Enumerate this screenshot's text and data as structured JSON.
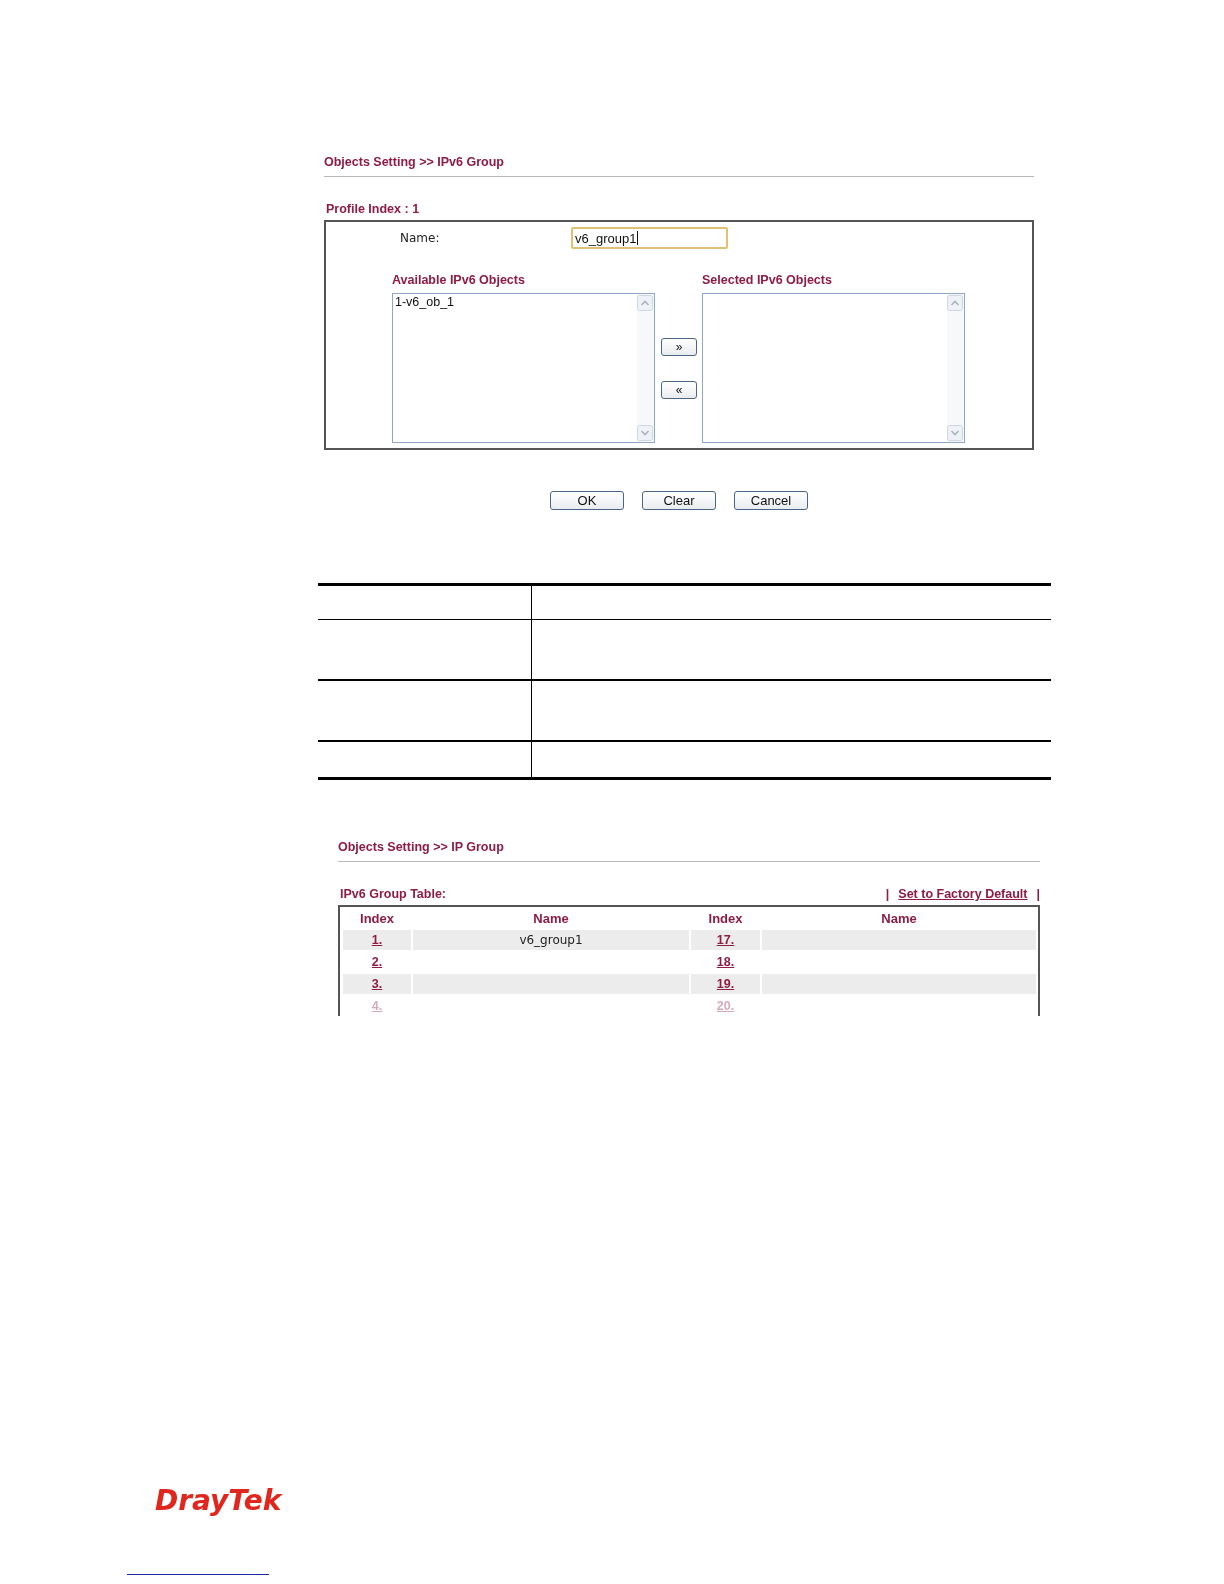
{
  "ipv6_group_page": {
    "breadcrumb": "Objects Setting >> IPv6 Group",
    "profile_index": "Profile Index : 1",
    "name_field": {
      "label": "Name:",
      "value": "v6_group1",
      "focused": true
    },
    "available_list": {
      "label": "Available IPv6 Objects",
      "items": [
        "1-v6_ob_1"
      ]
    },
    "move_buttons": [
      "»",
      "«"
    ],
    "selected_list": {
      "label": "Selected IPv6 Objects"
    },
    "buttons": [
      "OK",
      "Clear",
      "Cancel"
    ]
  },
  "ip_group_page": {
    "breadcrumb": "Objects Setting >> IP Group",
    "table_title": "IPv6 Group Table:",
    "factory_default": {
      "separator_left": "|",
      "link": "Set to Factory Default",
      "separator_right": "|"
    },
    "columns": [
      "Index",
      "Name",
      "Index",
      "Name"
    ],
    "rows": [
      {
        "cells": [
          {
            "index": "1.",
            "name": "v6_group1"
          },
          {
            "index": "17."
          }
        ]
      },
      {
        "cells": [
          {
            "index": "2."
          },
          {
            "index": "18."
          }
        ]
      },
      {
        "cells": [
          {
            "index": "3."
          },
          {
            "index": "19."
          }
        ]
      },
      {
        "cells": [
          {
            "index": "4."
          },
          {
            "index": "20."
          }
        ]
      }
    ]
  },
  "footer": {
    "logo": "DrayTek"
  }
}
